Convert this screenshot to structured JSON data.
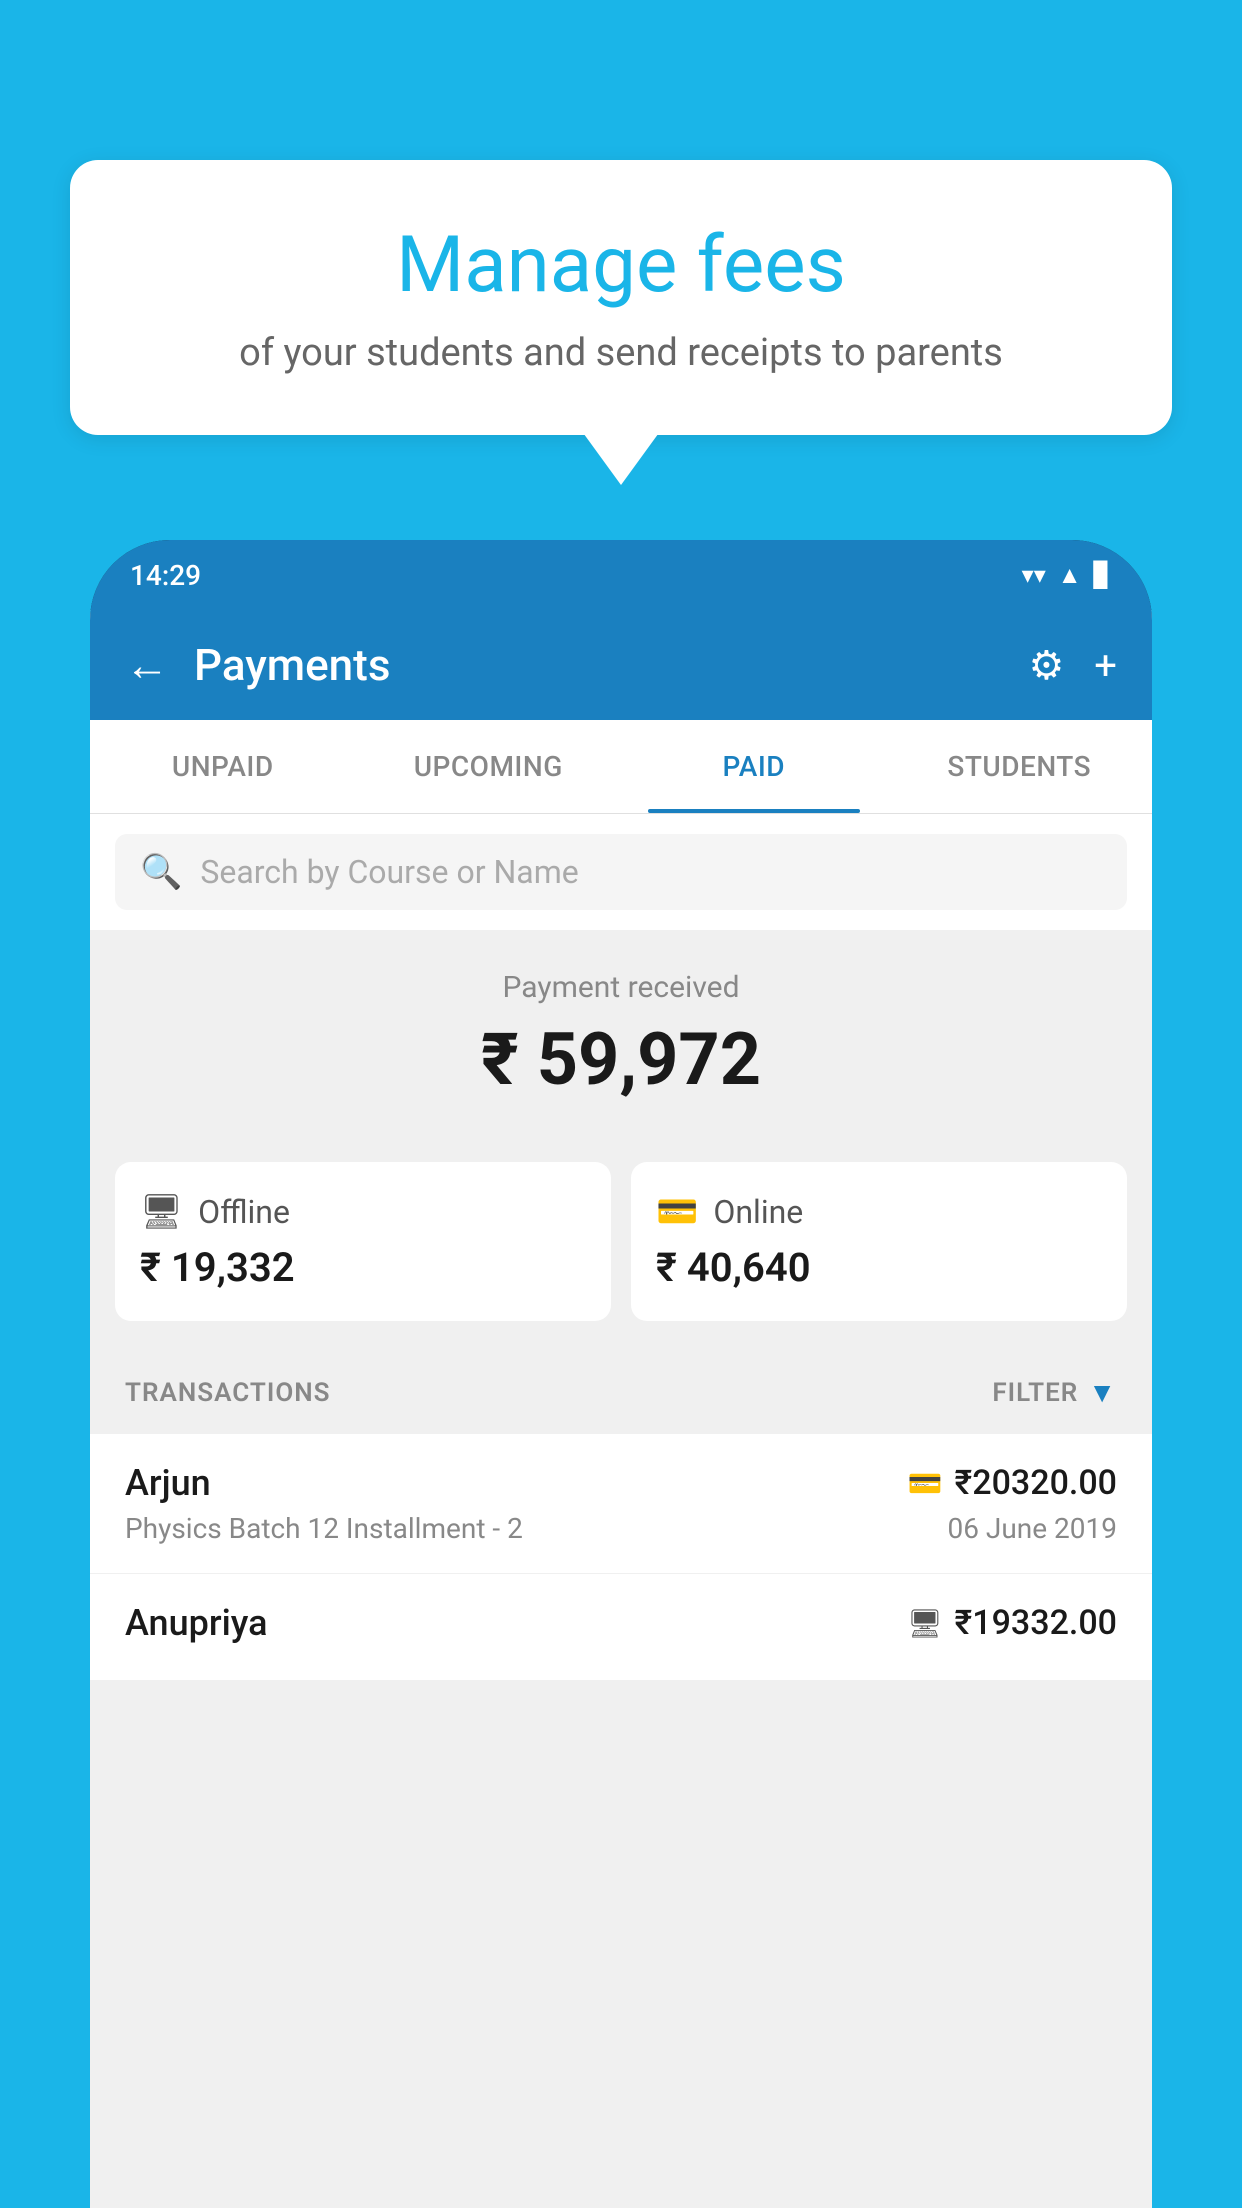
{
  "background_color": "#1ab5e8",
  "speech_bubble": {
    "title": "Manage fees",
    "subtitle": "of your students and send receipts to parents"
  },
  "phone": {
    "status_bar": {
      "time": "14:29",
      "wifi": "▼",
      "signal": "▲",
      "battery": "▊"
    },
    "header": {
      "title": "Payments",
      "back_label": "←",
      "gear_label": "⚙",
      "plus_label": "+"
    },
    "tabs": [
      {
        "id": "unpaid",
        "label": "UNPAID",
        "active": false
      },
      {
        "id": "upcoming",
        "label": "UPCOMING",
        "active": false
      },
      {
        "id": "paid",
        "label": "PAID",
        "active": true
      },
      {
        "id": "students",
        "label": "STUDENTS",
        "active": false
      }
    ],
    "search": {
      "placeholder": "Search by Course or Name"
    },
    "payment_summary": {
      "label": "Payment received",
      "amount": "₹ 59,972",
      "offline": {
        "type": "Offline",
        "amount": "₹ 19,332"
      },
      "online": {
        "type": "Online",
        "amount": "₹ 40,640"
      }
    },
    "transactions": {
      "header_label": "TRANSACTIONS",
      "filter_label": "FILTER",
      "rows": [
        {
          "name": "Arjun",
          "amount": "₹20320.00",
          "course": "Physics Batch 12 Installment - 2",
          "date": "06 June 2019",
          "payment_mode": "online"
        },
        {
          "name": "Anupriya",
          "amount": "₹19332.00",
          "course": "",
          "date": "",
          "payment_mode": "offline"
        }
      ]
    }
  }
}
